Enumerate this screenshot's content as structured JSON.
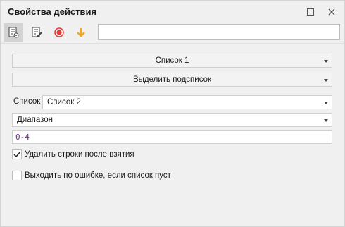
{
  "window": {
    "title": "Свойства действия"
  },
  "toolbar": {
    "top_input_value": ""
  },
  "dropdowns": {
    "list1": "Список 1",
    "select_sublist": "Выделить подсписок",
    "list_label": "Список",
    "list2": "Список 2",
    "range": "Диапазон"
  },
  "range_input": {
    "value": "0-4"
  },
  "checkboxes": {
    "remove_rows": {
      "label": "Удалить строки после взятия",
      "checked": true
    },
    "exit_on_error": {
      "label": "Выходить по ошибке, если список пуст",
      "checked": false
    }
  },
  "colors": {
    "accent_record": "#e53935",
    "accent_arrow": "#f5a623",
    "range_text": "#7a1fa2"
  },
  "icons": {
    "toolbar": [
      "properties-icon",
      "edit-note-icon",
      "record-icon",
      "arrow-down-icon"
    ],
    "window": [
      "maximize-icon",
      "close-icon"
    ]
  }
}
